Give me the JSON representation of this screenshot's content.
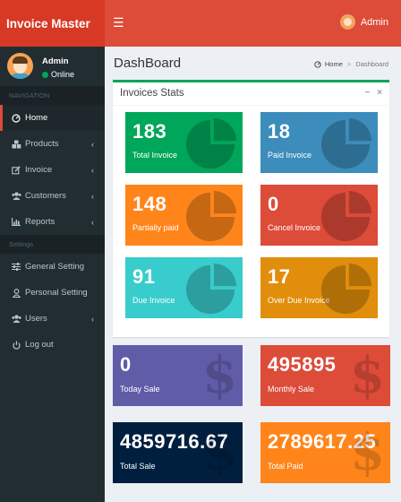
{
  "app": {
    "logo": "Invoice Master"
  },
  "topbar": {
    "menu_icon": "hamburger-icon",
    "user_name": "Admin"
  },
  "sidebar": {
    "user": {
      "name": "Admin",
      "status": "Online"
    },
    "navigation_header": "NAVIGATION",
    "settings_header": "Settings",
    "items": [
      {
        "label": "Home",
        "icon": "dashboard-icon",
        "active": true
      },
      {
        "label": "Products",
        "icon": "cubes-icon",
        "has_children": true
      },
      {
        "label": "Invoice",
        "icon": "edit-icon",
        "has_children": true
      },
      {
        "label": "Customers",
        "icon": "users-icon",
        "has_children": true
      },
      {
        "label": "Reports",
        "icon": "bar-chart-icon",
        "has_children": true
      }
    ],
    "settings_items": [
      {
        "label": "General Setting",
        "icon": "sliders-icon"
      },
      {
        "label": "Personal Setting",
        "icon": "user-icon"
      },
      {
        "label": "Users",
        "icon": "users-icon",
        "has_children": true
      },
      {
        "label": "Log out",
        "icon": "power-icon"
      }
    ]
  },
  "content": {
    "title": "DashBoard",
    "breadcrumb": {
      "home": "Home",
      "current": "Dashboard"
    }
  },
  "invoice_stats": {
    "title": "Invoices Stats",
    "tiles": [
      {
        "value": "183",
        "label": "Total Invoice",
        "color": "#00a65a"
      },
      {
        "value": "18",
        "label": "Paid Invoice",
        "color": "#3c8dbc"
      },
      {
        "value": "148",
        "label": "Partially paid",
        "color": "#ff851b"
      },
      {
        "value": "0",
        "label": "Cancel Invoice",
        "color": "#dd4b39"
      },
      {
        "value": "91",
        "label": "Due Invoice",
        "color": "#39cccc"
      },
      {
        "value": "17",
        "label": "Over Due Invoice",
        "color": "#e08e0b"
      }
    ]
  },
  "sales": {
    "tiles": [
      {
        "value": "0",
        "label": "Today Sale",
        "color": "#605ca8"
      },
      {
        "value": "495895",
        "label": "Monthly Sale",
        "color": "#dd4b39"
      },
      {
        "value": "4859716.67",
        "label": "Total Sale",
        "color": "#001f3f"
      },
      {
        "value": "2789617.25",
        "label": "Total Paid",
        "color": "#ff851b"
      }
    ]
  }
}
